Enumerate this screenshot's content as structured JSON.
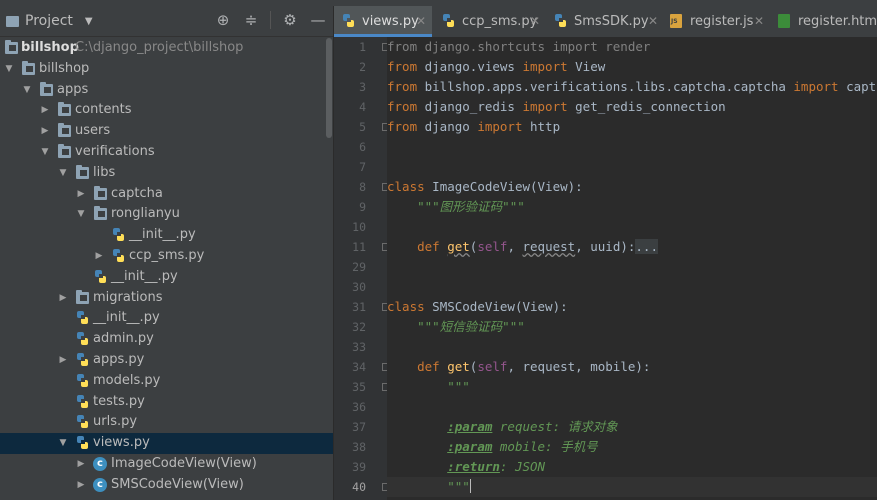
{
  "project_panel": {
    "title": "Project",
    "tree": [
      {
        "label": "billshop",
        "path": "C:\\django_project\\billshop",
        "type": "root"
      },
      {
        "label": "billshop",
        "type": "folder"
      },
      {
        "label": "apps",
        "type": "folder"
      },
      {
        "label": "contents",
        "type": "folder"
      },
      {
        "label": "users",
        "type": "folder"
      },
      {
        "label": "verifications",
        "type": "folder"
      },
      {
        "label": "libs",
        "type": "folder"
      },
      {
        "label": "captcha",
        "type": "folder"
      },
      {
        "label": "ronglianyu",
        "type": "folder"
      },
      {
        "label": "__init__.py",
        "type": "py"
      },
      {
        "label": "ccp_sms.py",
        "type": "py"
      },
      {
        "label": "__init__.py",
        "type": "py"
      },
      {
        "label": "migrations",
        "type": "folder"
      },
      {
        "label": "__init__.py",
        "type": "py"
      },
      {
        "label": "admin.py",
        "type": "py"
      },
      {
        "label": "apps.py",
        "type": "py"
      },
      {
        "label": "models.py",
        "type": "py"
      },
      {
        "label": "tests.py",
        "type": "py"
      },
      {
        "label": "urls.py",
        "type": "py"
      },
      {
        "label": "views.py",
        "type": "py",
        "selected": true
      },
      {
        "label": "ImageCodeView(View)",
        "type": "class"
      },
      {
        "label": "SMSCodeView(View)",
        "type": "class"
      }
    ]
  },
  "tabs": [
    {
      "label": "views.py",
      "active": true
    },
    {
      "label": "ccp_sms.py"
    },
    {
      "label": "SmsSDK.py"
    },
    {
      "label": "register.js"
    },
    {
      "label": "register.html"
    }
  ],
  "editor": {
    "current_line": "40",
    "line_numbers": [
      "1",
      "2",
      "3",
      "4",
      "5",
      "6",
      "7",
      "8",
      "9",
      "10",
      "11",
      "29",
      "30",
      "31",
      "32",
      "33",
      "34",
      "35",
      "36",
      "37",
      "38",
      "39",
      "40"
    ],
    "code": {
      "l1a": "from",
      "l1b": " django.shortcuts ",
      "l1c": "import",
      "l1d": " render",
      "l2a": "from",
      "l2b": " django.views ",
      "l2c": "import",
      "l2d": " View",
      "l3a": "from",
      "l3b": " billshop.apps.verifications.libs.captcha.captcha ",
      "l3c": "import",
      "l3d": " captcha",
      "l4a": "from",
      "l4b": " django_redis ",
      "l4c": "import",
      "l4d": " get_redis_connection",
      "l5a": "from",
      "l5b": " django ",
      "l5c": "import",
      "l5d": " http",
      "l8a": "class",
      "l8b": " ImageCodeView(View):",
      "l9": "    \"\"\"图形验证码\"\"\"",
      "l11a": "    def ",
      "l11b": "get",
      "l11c": "(",
      "l11d": "self",
      "l11e": ", ",
      "l11f": "request",
      "l11g": ", uuid):",
      "l11h": "...",
      "l31a": "class",
      "l31b": " SMSCodeView(View):",
      "l32": "    \"\"\"短信验证码\"\"\"",
      "l34a": "    def ",
      "l34b": "get",
      "l34c": "(",
      "l34d": "self",
      "l34e": ", request, mobile):",
      "l35": "        \"\"\"",
      "l37a": ":param",
      "l37b": " request: 请求对象",
      "l38a": ":param",
      "l38b": " mobile: 手机号",
      "l39a": ":return",
      "l39b": ": JSON",
      "l40": "        \"\"\""
    }
  }
}
